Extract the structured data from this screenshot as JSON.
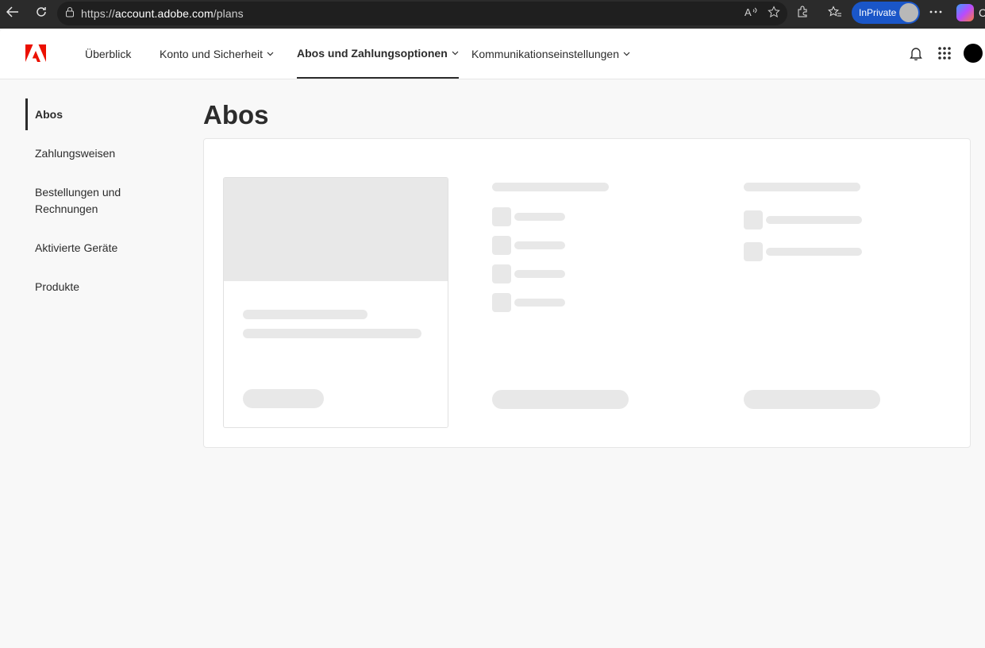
{
  "browser": {
    "url_scheme": "https://",
    "url_host": "account.adobe.com",
    "url_path": "/plans",
    "inprivate_label": "InPrivate"
  },
  "header": {
    "nav": [
      {
        "label": "Überblick",
        "has_dropdown": false,
        "active": false
      },
      {
        "label": "Konto und Sicherheit",
        "has_dropdown": true,
        "active": false
      },
      {
        "label": "Abos und Zahlungsoptionen",
        "has_dropdown": true,
        "active": true
      },
      {
        "label": "Kommunikationseinstellungen",
        "has_dropdown": true,
        "active": false
      }
    ],
    "icons": [
      "bell-icon",
      "app-grid-icon"
    ]
  },
  "sidebar": {
    "items": [
      {
        "label": "Abos",
        "active": true
      },
      {
        "label": "Zahlungsweisen",
        "active": false
      },
      {
        "label": "Bestellungen und Rechnungen",
        "active": false
      },
      {
        "label": "Aktivierte Geräte",
        "active": false
      },
      {
        "label": "Produkte",
        "active": false
      }
    ]
  },
  "main": {
    "title": "Abos",
    "loading": true
  },
  "colors": {
    "adobe_red": "#eb1000",
    "skeleton": "#e8e8e8",
    "inprivate_blue": "#1a56c8"
  }
}
